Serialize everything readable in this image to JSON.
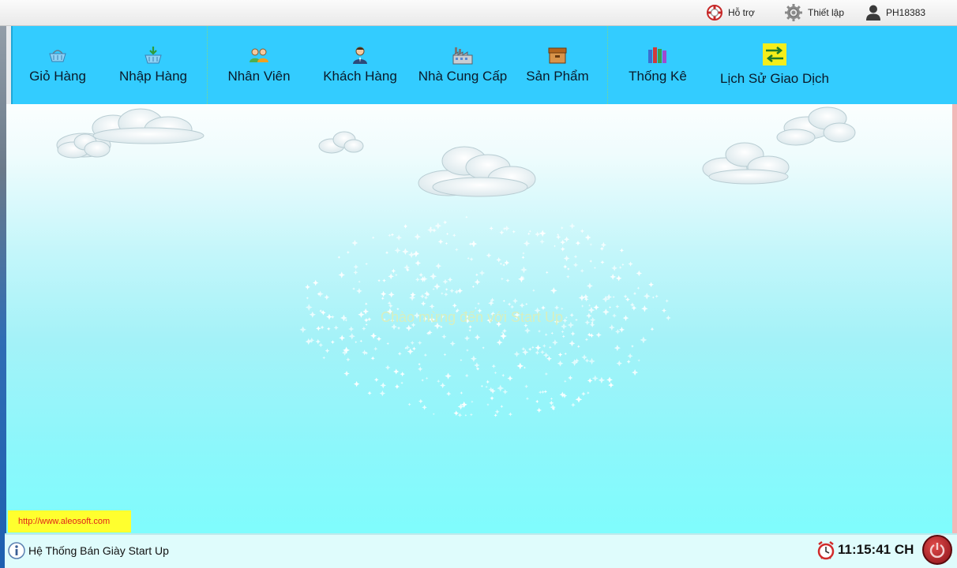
{
  "topbar": {
    "support_label": "Hỗ trợ",
    "settings_label": "Thiết lập",
    "user_label": "PH18383"
  },
  "ribbon": {
    "items": [
      {
        "label": "Giỏ Hàng",
        "icon": "basket-icon"
      },
      {
        "label": "Nhập Hàng",
        "icon": "basket-import-icon"
      },
      {
        "label": "Nhân Viên",
        "icon": "employees-icon"
      },
      {
        "label": "Khách Hàng",
        "icon": "customer-icon"
      },
      {
        "label": "Nhà Cung Cấp",
        "icon": "factory-icon"
      },
      {
        "label": "Sản Phẩm",
        "icon": "box-icon"
      },
      {
        "label": "Thống Kê",
        "icon": "books-icon"
      },
      {
        "label": "Lịch Sử Giao Dịch",
        "icon": "exchange-arrows-icon"
      }
    ]
  },
  "main": {
    "welcome_text": "Chào mừng đến với Start Up",
    "site_link": "http://www.aleosoft.com"
  },
  "statusbar": {
    "app_name": "Hệ Thống Bán Giày Start Up",
    "clock": "11:15:41 CH"
  },
  "colors": {
    "ribbon": "#33ccff",
    "link_bg": "#ffff2e",
    "link_text": "#e0231b",
    "power_button": "#b0202a"
  }
}
